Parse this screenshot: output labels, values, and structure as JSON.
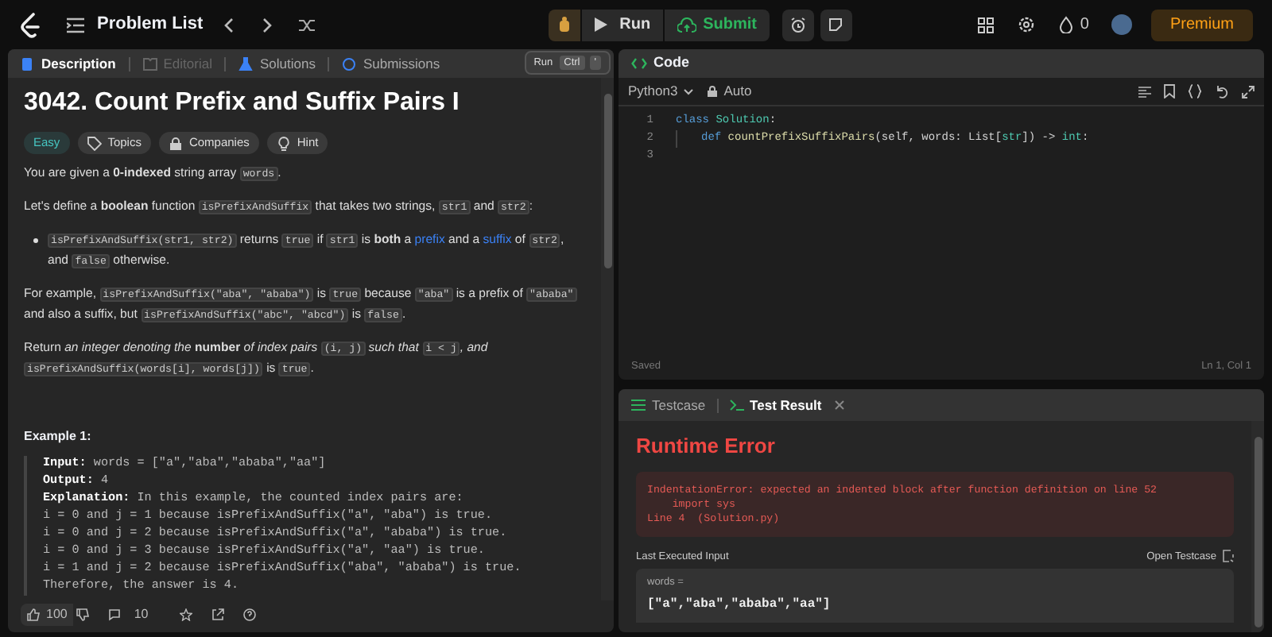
{
  "topbar": {
    "nav_label": "Problem List",
    "run": "Run",
    "submit": "Submit",
    "streak": "0",
    "premium": "Premium"
  },
  "tooltip": {
    "label": "Run",
    "keys": [
      "Ctrl",
      "'"
    ]
  },
  "left_tabs": [
    {
      "label": "Description",
      "selected": true,
      "disabled": false
    },
    {
      "label": "Editorial",
      "selected": false,
      "disabled": true
    },
    {
      "label": "Solutions",
      "selected": false,
      "disabled": false
    },
    {
      "label": "Submissions",
      "selected": false,
      "disabled": false
    }
  ],
  "problem": {
    "title": "3042. Count Prefix and Suffix Pairs I",
    "difficulty": "Easy",
    "tags": [
      {
        "kind": "tag",
        "label": "Topics"
      },
      {
        "kind": "lock",
        "label": "Companies"
      },
      {
        "kind": "bulb",
        "label": "Hint"
      }
    ],
    "paragraphs": [
      {
        "kind": "para",
        "segments": [
          {
            "kind": "text",
            "text": "You are given a **0-indexed** string array "
          },
          {
            "kind": "code",
            "text": "words"
          },
          {
            "kind": "text",
            "text": "."
          }
        ]
      },
      {
        "kind": "para",
        "segments": [
          {
            "kind": "text",
            "text": "Let's define a **boolean** function "
          },
          {
            "kind": "code",
            "text": "isPrefixAndSuffix"
          },
          {
            "kind": "text",
            "text": " that takes two strings, "
          },
          {
            "kind": "code",
            "text": "str1"
          },
          {
            "kind": "text",
            "text": " and "
          },
          {
            "kind": "code",
            "text": "str2"
          },
          {
            "kind": "text",
            "text": ":"
          }
        ]
      },
      {
        "kind": "bullet",
        "segments": [
          {
            "kind": "code",
            "text": "isPrefixAndSuffix(str1, str2)"
          },
          {
            "kind": "text",
            "text": " returns "
          },
          {
            "kind": "code",
            "text": "true"
          },
          {
            "kind": "text",
            "text": " if "
          },
          {
            "kind": "code",
            "text": "str1"
          },
          {
            "kind": "text",
            "text": " is **both** a "
          },
          {
            "kind": "link",
            "text": "prefix"
          },
          {
            "kind": "text",
            "text": " and a "
          },
          {
            "kind": "link",
            "text": "suffix"
          },
          {
            "kind": "text",
            "text": " of "
          },
          {
            "kind": "code",
            "text": "str2"
          },
          {
            "kind": "text",
            "text": ", and "
          },
          {
            "kind": "code",
            "text": "false"
          },
          {
            "kind": "text",
            "text": " otherwise."
          }
        ]
      },
      {
        "kind": "para",
        "segments": [
          {
            "kind": "text",
            "text": "For example, "
          },
          {
            "kind": "code",
            "text": "isPrefixAndSuffix(\"aba\", \"ababa\")"
          },
          {
            "kind": "text",
            "text": " is "
          },
          {
            "kind": "code",
            "text": "true"
          },
          {
            "kind": "text",
            "text": " because "
          },
          {
            "kind": "code",
            "text": "\"aba\""
          },
          {
            "kind": "text",
            "text": " is a prefix of "
          },
          {
            "kind": "code",
            "text": "\"ababa\""
          },
          {
            "kind": "text",
            "text": " and also a suffix, but "
          },
          {
            "kind": "code",
            "text": "isPrefixAndSuffix(\"abc\", \"abcd\")"
          },
          {
            "kind": "text",
            "text": " is "
          },
          {
            "kind": "code",
            "text": "false"
          },
          {
            "kind": "text",
            "text": "."
          }
        ]
      },
      {
        "kind": "para",
        "segments": [
          {
            "kind": "text",
            "text": "Return *an integer denoting the* **number** *of index pairs* "
          },
          {
            "kind": "code",
            "text": "(i, j)"
          },
          {
            "kind": "text",
            "text": " *such that* "
          },
          {
            "kind": "code",
            "text": "i < j"
          },
          {
            "kind": "text",
            "text": "*, and* "
          },
          {
            "kind": "code",
            "text": "isPrefixAndSuffix(words[i], words[j])"
          },
          {
            "kind": "text",
            "text": " is "
          },
          {
            "kind": "code",
            "text": "true"
          },
          {
            "kind": "text",
            "text": "."
          }
        ]
      }
    ],
    "example": {
      "title": "Example 1:",
      "lines": [
        "**Input:** words = [\"a\",\"aba\",\"ababa\",\"aa\"]",
        "**Output:** 4",
        "**Explanation:** In this example, the counted index pairs are:",
        "i = 0 and j = 1 because isPrefixAndSuffix(\"a\", \"aba\") is true.",
        "i = 0 and j = 2 because isPrefixAndSuffix(\"a\", \"ababa\") is true.",
        "i = 0 and j = 3 because isPrefixAndSuffix(\"a\", \"aa\") is true.",
        "i = 1 and j = 2 because isPrefixAndSuffix(\"aba\", \"ababa\") is true.",
        "Therefore, the answer is 4."
      ]
    }
  },
  "footer": {
    "likes": "100",
    "comments": "10"
  },
  "code": {
    "title": "Code",
    "language": "Python3",
    "mode": "Auto",
    "lines": [
      {
        "number": "1",
        "indented": false,
        "tokens": [
          {
            "kind": "keyword",
            "text": "class"
          },
          {
            "kind": "type",
            "text": " Solution"
          },
          {
            "kind": "plain",
            "text": ":"
          }
        ]
      },
      {
        "number": "2",
        "indented": true,
        "tokens": [
          {
            "kind": "keyword",
            "text": "def"
          },
          {
            "kind": "function",
            "text": " countPrefixSuffixPairs"
          },
          {
            "kind": "plain",
            "text": "(self, words: List["
          },
          {
            "kind": "type",
            "text": "str"
          },
          {
            "kind": "plain",
            "text": "]) -> "
          },
          {
            "kind": "type",
            "text": "int"
          },
          {
            "kind": "plain",
            "text": ":"
          }
        ]
      },
      {
        "number": "3",
        "indented": false
      }
    ],
    "status": "Saved",
    "cursor": "Ln 1, Col 1"
  },
  "result": {
    "tabs": [
      {
        "label": "Testcase",
        "selected": false
      },
      {
        "label": "Test Result",
        "selected": true
      }
    ],
    "status": "Runtime Error",
    "error_lines": [
      "IndentationError: expected an indented block after function definition on line 52",
      "    import sys",
      "Line 4  (Solution.py)"
    ],
    "last_input_label": "Last Executed Input",
    "open_testcase": "Open Testcase",
    "input_name": "words =",
    "input_value": "[\"a\",\"aba\",\"ababa\",\"aa\"]"
  }
}
